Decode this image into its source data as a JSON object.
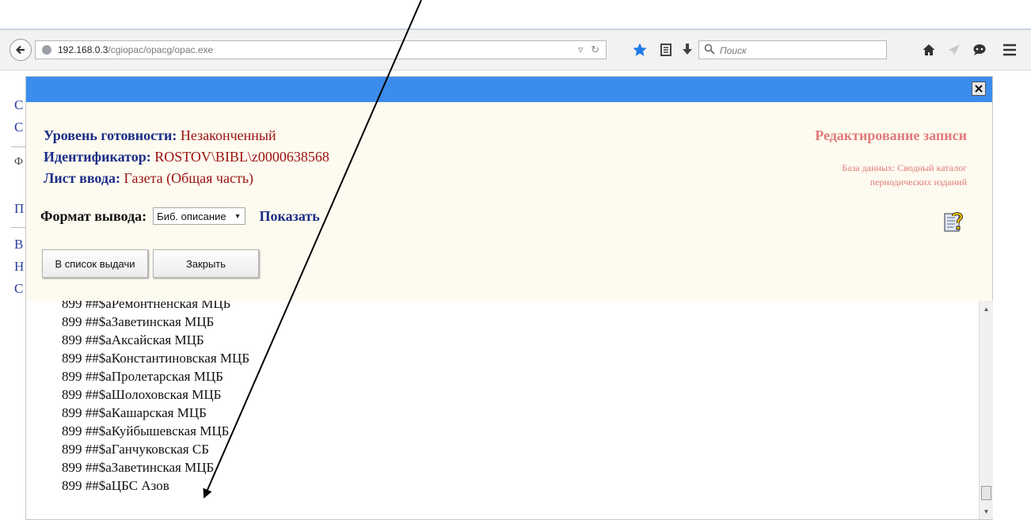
{
  "browser": {
    "url_host": "192.168.0.3",
    "url_path": "/cgiopac/opacg/opac.exe",
    "search_placeholder": "Поиск"
  },
  "background_page": {
    "letters": [
      "С",
      "С",
      "Ф",
      "П",
      "В",
      "Н",
      "С"
    ]
  },
  "modal": {
    "info": {
      "readiness_label": "Уровень готовности:",
      "readiness_value": "Незаконченный",
      "id_label": "Идентификатор:",
      "id_value": "ROSTOV\\BIBL\\z0000638568",
      "sheet_label": "Лист ввода:",
      "sheet_value": "Газета (Общая часть)"
    },
    "edit_title": "Редактирование записи",
    "db_line1": "База данных: Сводный каталог",
    "db_line2": "периодических изданий",
    "format_label": "Формат вывода:",
    "format_selected": "Биб. описание",
    "show_link": "Показать",
    "buttons": {
      "to_list": "В список выдачи",
      "close": "Закрыть"
    },
    "record_lines": [
      "899 ##$aРемонтненская МЦБ",
      "899 ##$aЗаветинская МЦБ",
      "899 ##$aАксайская МЦБ",
      "899 ##$aКонстантиновская МЦБ",
      "899 ##$aПролетарская МЦБ",
      "899 ##$aШолоховская МЦБ",
      "899 ##$aКашарская МЦБ",
      "899 ##$aКуйбышевская МЦБ",
      "899 ##$aГанчуковская СБ",
      "899 ##$aЗаветинская МЦБ",
      "899 ##$aЦБС Азов"
    ]
  },
  "colors": {
    "titlebar": "#3b8ced",
    "label_blue": "#1c2d87",
    "value_red": "#9b1010",
    "accent_pink": "#e07a7a"
  }
}
